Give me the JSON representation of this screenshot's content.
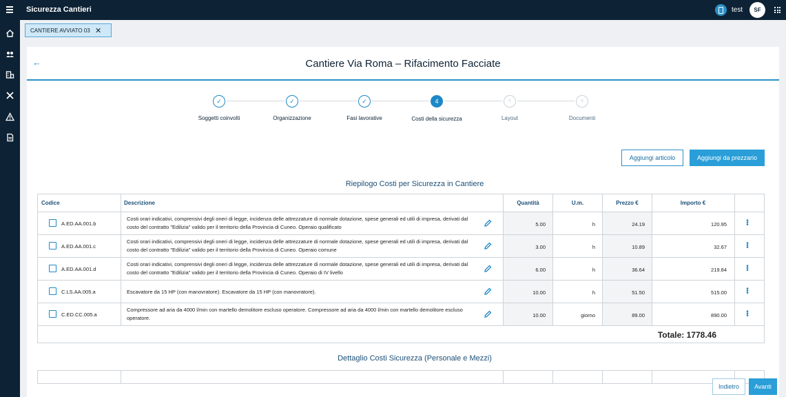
{
  "app": {
    "title": "Sicurezza Cantieri",
    "user": "test",
    "avatar_initials": "SF"
  },
  "tab": {
    "label": "CANTIERE AVVIATO 03"
  },
  "page": {
    "title": "Cantiere Via Roma – Rifacimento Facciate"
  },
  "steps": [
    {
      "label": "Soggetti coinvolti",
      "state": "done",
      "marker": "✓"
    },
    {
      "label": "Organizzazione",
      "state": "done",
      "marker": "✓"
    },
    {
      "label": "Fasi lavorative",
      "state": "done",
      "marker": "✓"
    },
    {
      "label": "Costi della sicurezza",
      "state": "active",
      "marker": "4"
    },
    {
      "label": "Layout",
      "state": "todo",
      "marker": "5"
    },
    {
      "label": "Documenti",
      "state": "todo",
      "marker": "6"
    }
  ],
  "actions": {
    "add_article": "Aggiungi articolo",
    "add_from_pricelist": "Aggiungi da prezzario"
  },
  "summary": {
    "title": "Riepilogo Costi per Sicurezza in Cantiere",
    "columns": {
      "code": "Codice",
      "description": "Descrizione",
      "quantity": "Quantità",
      "unit": "U.m.",
      "price": "Prezzo €",
      "amount": "Importo €"
    },
    "rows": [
      {
        "code": "A.ED.AA.001.b",
        "description": "Costi orari indicativi, comprensivi degli oneri di legge, incidenza delle attrezzature di normale dotazione, spese generali ed utili di impresa, derivati dal costo del contratto \"Edilizia\" valido per il territorio della Provincia di Cuneo. Operaio qualificato",
        "quantity": "5.00",
        "unit": "h",
        "price": "24.19",
        "amount": "120.95"
      },
      {
        "code": "A.ED.AA.001.c",
        "description": "Costi orari indicativi, comprensivi degli oneri di legge, incidenza delle attrezzature di normale dotazione, spese generali ed utili di impresa, derivati dal costo del contratto \"Edilizia\" valido per il territorio della Provincia di Cuneo. Operaio comune",
        "quantity": "3.00",
        "unit": "h",
        "price": "10.89",
        "amount": "32.67"
      },
      {
        "code": "A.ED.AA.001.d",
        "description": "Costi orari indicativi, comprensivi degli oneri di legge, incidenza delle attrezzature di normale dotazione, spese generali ed utili di impresa, derivati dal costo del contratto \"Edilizia\" valido per il territorio della Provincia di Cuneo. Operaio di IV livello",
        "quantity": "6.00",
        "unit": "h",
        "price": "36.64",
        "amount": "219.84"
      },
      {
        "code": "C.LS.AA.005.a",
        "description": "Escavatore da 15 HP (con manovratore). Escavatore da 15 HP (con manovratore).",
        "quantity": "10.00",
        "unit": "h",
        "price": "51.50",
        "amount": "515.00"
      },
      {
        "code": "C.ED.CC.005.a",
        "description": "Compressore ad aria da 4000 l/min con martello demolitore escluso operatore. Compressore ad aria da 4000 l/min con martello demolitore escluso operatore.",
        "quantity": "10.00",
        "unit": "giorno",
        "price": "89.00",
        "amount": "890.00"
      }
    ],
    "total": "Totale: 1778.46"
  },
  "detail": {
    "title": "Dettaglio Costi Sicurezza (Personale e Mezzi)"
  },
  "footer": {
    "prev": "Indietro",
    "next": "Avanti"
  }
}
